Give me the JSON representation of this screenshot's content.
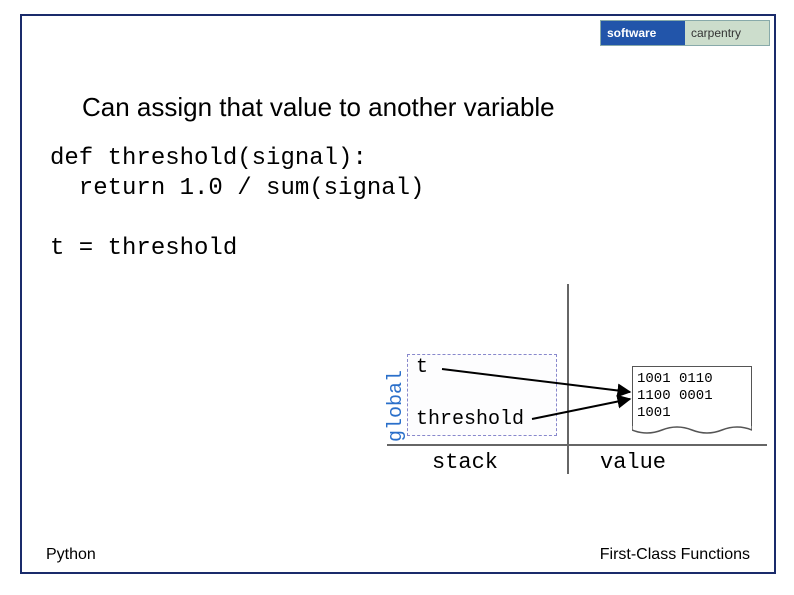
{
  "logo": {
    "left": "software",
    "right": "carpentry"
  },
  "title": "Can assign that value to another variable",
  "code": {
    "def_line": "def threshold(signal):",
    "return_line": "  return 1.0 / sum(signal)",
    "assign_line": "t = threshold"
  },
  "diagram": {
    "scope_label": "global",
    "var_t": "t",
    "var_threshold": "threshold",
    "stack_label": "stack",
    "value_label": "value",
    "bits": "1001 0110\n1100 0001\n1001"
  },
  "footer": {
    "left": "Python",
    "right": "First-Class Functions"
  }
}
